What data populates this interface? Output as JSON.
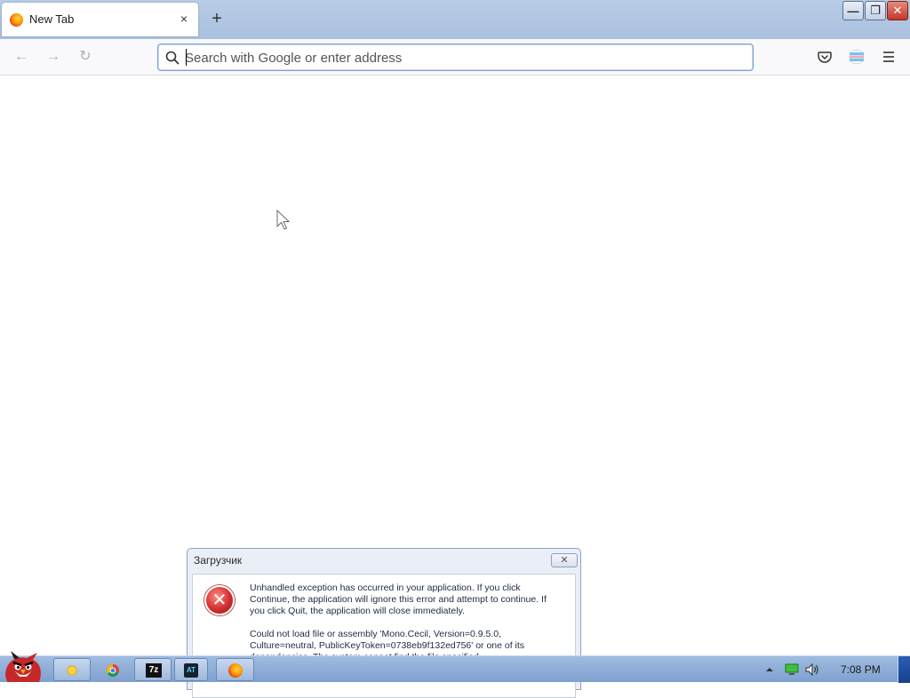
{
  "browser": {
    "tab": {
      "title": "New Tab",
      "close_glyph": "×"
    },
    "new_tab_glyph": "+",
    "url_placeholder": "Search with Google or enter address",
    "nav": {
      "back_glyph": "←",
      "forward_glyph": "→",
      "reload_glyph": "↻"
    },
    "window_buttons": {
      "minimize": "—",
      "restore": "❐",
      "close": "✕"
    }
  },
  "dialog": {
    "title": "Загрузчик",
    "close_glyph": "✕",
    "icon": "error-icon",
    "icon_glyph": "✕",
    "message_1": "Unhandled exception has occurred in your application. If you click Continue, the application will ignore this error and attempt to continue. If you click Quit, the application will close immediately.",
    "message_2": "Could not load file or assembly 'Mono.Cecil, Version=0.9.5.0, Culture=neutral, PublicKeyToken=0738eb9f132ed756' or one of its dependencies. The system cannot find the file specified."
  },
  "taskbar": {
    "items": [
      "start-angry-birds",
      "app-1",
      "chrome",
      "7zip",
      "app-4",
      "firefox"
    ],
    "seven_zip_label": "7z",
    "app4_label": "AT",
    "time": "7:08 PM"
  },
  "colors": {
    "tabstrip": "#b9cce6",
    "taskbar": "#9fbbe0",
    "urlbar_border": "#7aa1d4",
    "error_red": "#d32f2f"
  }
}
